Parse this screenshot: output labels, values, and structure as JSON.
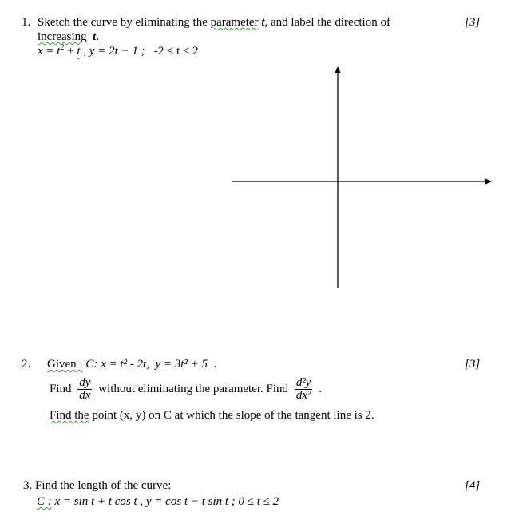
{
  "questions": [
    {
      "number": "1.",
      "text_a": "Sketch the curve by eliminating",
      "text_b": "the",
      "squig_word": "parameter",
      "var_t": "t",
      "text_c": ", and label the direction of",
      "line2_squig": "increasing",
      "line2_var": "t",
      "line2_end": ".",
      "equation": {
        "x_part": "x = t",
        "x_exp": "2",
        "plus": " + ",
        "t_squig": "t",
        "comma": " ,",
        "y_part": " y = 2t − 1 ;",
        "range": "-2 ≤ t ≤ 2"
      },
      "marks": "[3]"
    },
    {
      "number": "2.",
      "given_squig": "Given :",
      "curve": "C:",
      "eq_x": "x = t² - 2t,",
      "eq_y": "y = 3t² + 5",
      "eq_end": ".",
      "find1": "Find",
      "frac1_num": "dy",
      "frac1_den": "dx",
      "mid_text": "without eliminating the parameter.  Find",
      "frac2_num": "d²y",
      "frac2_den": "dx²",
      "frac2_end": ".",
      "line3_squig": "Find  the",
      "line3_rest": "point (x, y) on C at which the slope of the tangent line is  2.",
      "marks": "[3]"
    },
    {
      "number": "3.",
      "text": "Find the length of the curve:",
      "curve_squig": "C :",
      "equation": "x = sin t + t cos t ,  y = cos t − t sin t  ;   0 ≤ t ≤ 2",
      "marks": "[4]"
    }
  ],
  "axes_figure": {
    "x_axis_label": "",
    "y_axis_label": ""
  }
}
